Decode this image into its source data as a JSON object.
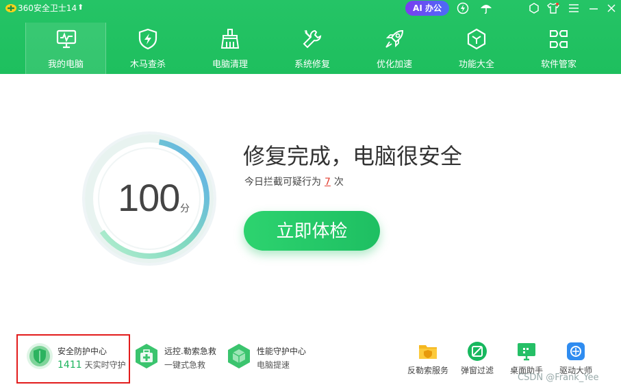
{
  "titlebar": {
    "title": "360安全卫士14",
    "update_arrow": "⬆",
    "ai_badge": "AI 办公"
  },
  "nav": [
    {
      "label": "我的电脑",
      "icon": "monitor-icon",
      "active": true
    },
    {
      "label": "木马查杀",
      "icon": "shield-bolt-icon"
    },
    {
      "label": "电脑清理",
      "icon": "broom-icon"
    },
    {
      "label": "系统修复",
      "icon": "wrench-icon"
    },
    {
      "label": "优化加速",
      "icon": "rocket-icon"
    },
    {
      "label": "功能大全",
      "icon": "cube-icon"
    },
    {
      "label": "软件管家",
      "icon": "apps-icon"
    }
  ],
  "score": {
    "value": "100",
    "unit": "分"
  },
  "status": {
    "headline": "修复完成，电脑很安全",
    "sub_prefix": "今日拦截可疑行为",
    "sub_count": "7",
    "sub_suffix": "次"
  },
  "check_button": "立即体检",
  "features": [
    {
      "title": "安全防护中心",
      "count": "1411",
      "sub": "天实时守护",
      "icon": "shield-green-icon"
    },
    {
      "title": "远控.勒索急救",
      "sub": "一键式急救",
      "icon": "first-aid-icon"
    },
    {
      "title": "性能守护中心",
      "sub": "电脑提速",
      "icon": "performance-cube-icon"
    }
  ],
  "tools": [
    {
      "label": "反勒索服务",
      "icon": "folder-lock-icon"
    },
    {
      "label": "弹窗过滤",
      "icon": "popup-block-icon"
    },
    {
      "label": "桌面助手",
      "icon": "desktop-icon"
    },
    {
      "label": "驱动大师",
      "icon": "driver-icon"
    }
  ],
  "watermark": "CSDN @Frank_Yee",
  "colors": {
    "brand_green": "#1ebf5e",
    "alert_red": "#e23b2e",
    "highlight_red": "#e21b1b"
  }
}
